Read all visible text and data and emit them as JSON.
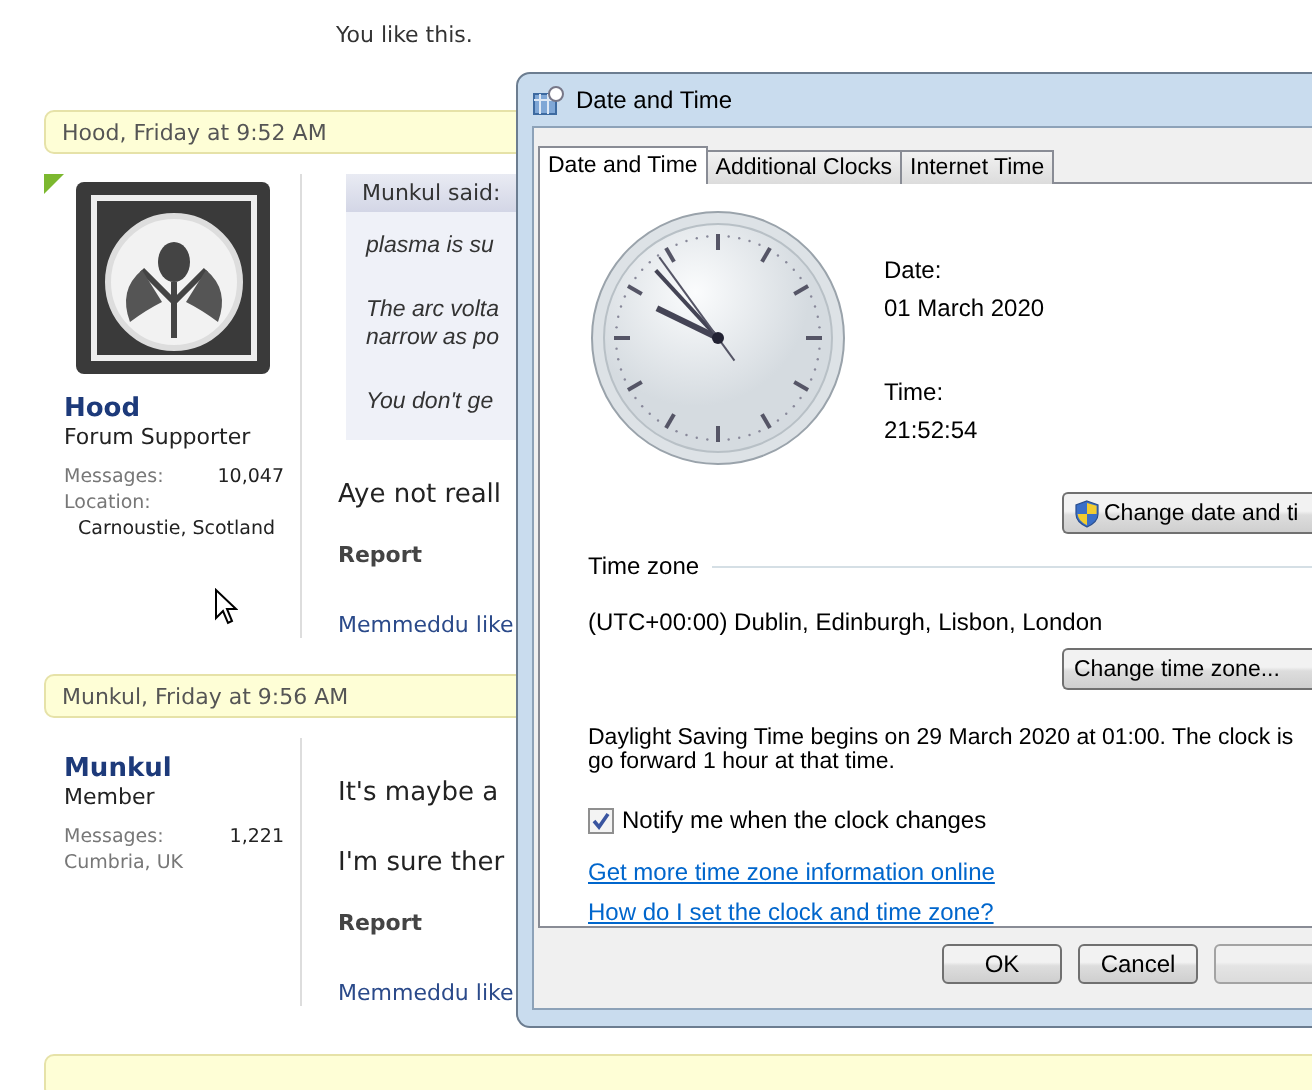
{
  "forum": {
    "like_note": "You like this.",
    "posts": [
      {
        "header": "Hood, Friday at 9:52 AM",
        "online": true,
        "has_avatar": true,
        "author": {
          "name": "Hood",
          "title": "Forum Supporter",
          "stats": [
            {
              "kind": "pair",
              "label": "Messages:",
              "value": "10,047"
            },
            {
              "kind": "stacked",
              "label": "Location:",
              "value": "Carnoustie, Scotland"
            }
          ]
        },
        "quote": {
          "header": "Munkul said:",
          "paragraphs": [
            [
              "plasma is su"
            ],
            [
              "The arc volta",
              "narrow as po"
            ],
            [
              "You don't ge"
            ]
          ]
        },
        "paragraphs": [
          "Aye not reall"
        ],
        "report": "Report",
        "likes": "Memmeddu like"
      },
      {
        "header": "Munkul, Friday at 9:56 AM",
        "online": false,
        "has_avatar": false,
        "author": {
          "name": "Munkul",
          "title": "Member",
          "stats": [
            {
              "kind": "pair",
              "label": "Messages:",
              "value": "1,221"
            },
            {
              "kind": "plain",
              "value": "Cumbria, UK"
            }
          ]
        },
        "paragraphs": [
          "It's maybe a",
          "I'm sure ther"
        ],
        "report": "Report",
        "likes": "Memmeddu like"
      }
    ]
  },
  "dialog": {
    "title": "Date and Time",
    "tabs": [
      {
        "label": "Date and Time",
        "selected": true
      },
      {
        "label": "Additional Clocks",
        "selected": false
      },
      {
        "label": "Internet Time",
        "selected": false
      }
    ],
    "date_label": "Date:",
    "date": "01 March 2020",
    "time_label": "Time:",
    "time": "21:52:54",
    "change_datetime_button": "Change date and ti",
    "timezone_group": "Time zone",
    "timezone": "(UTC+00:00) Dublin, Edinburgh, Lisbon, London",
    "change_timezone_button": "Change time zone...",
    "dst_lines": [
      "Daylight Saving Time begins on 29 March 2020 at 01:00. The clock is",
      "go forward 1 hour at that time."
    ],
    "notify": {
      "label": "Notify me when the clock changes",
      "checked": true
    },
    "links": [
      "Get more time zone information online",
      "How do I set the clock and time zone?"
    ],
    "buttons": [
      "OK",
      "Cancel"
    ]
  }
}
